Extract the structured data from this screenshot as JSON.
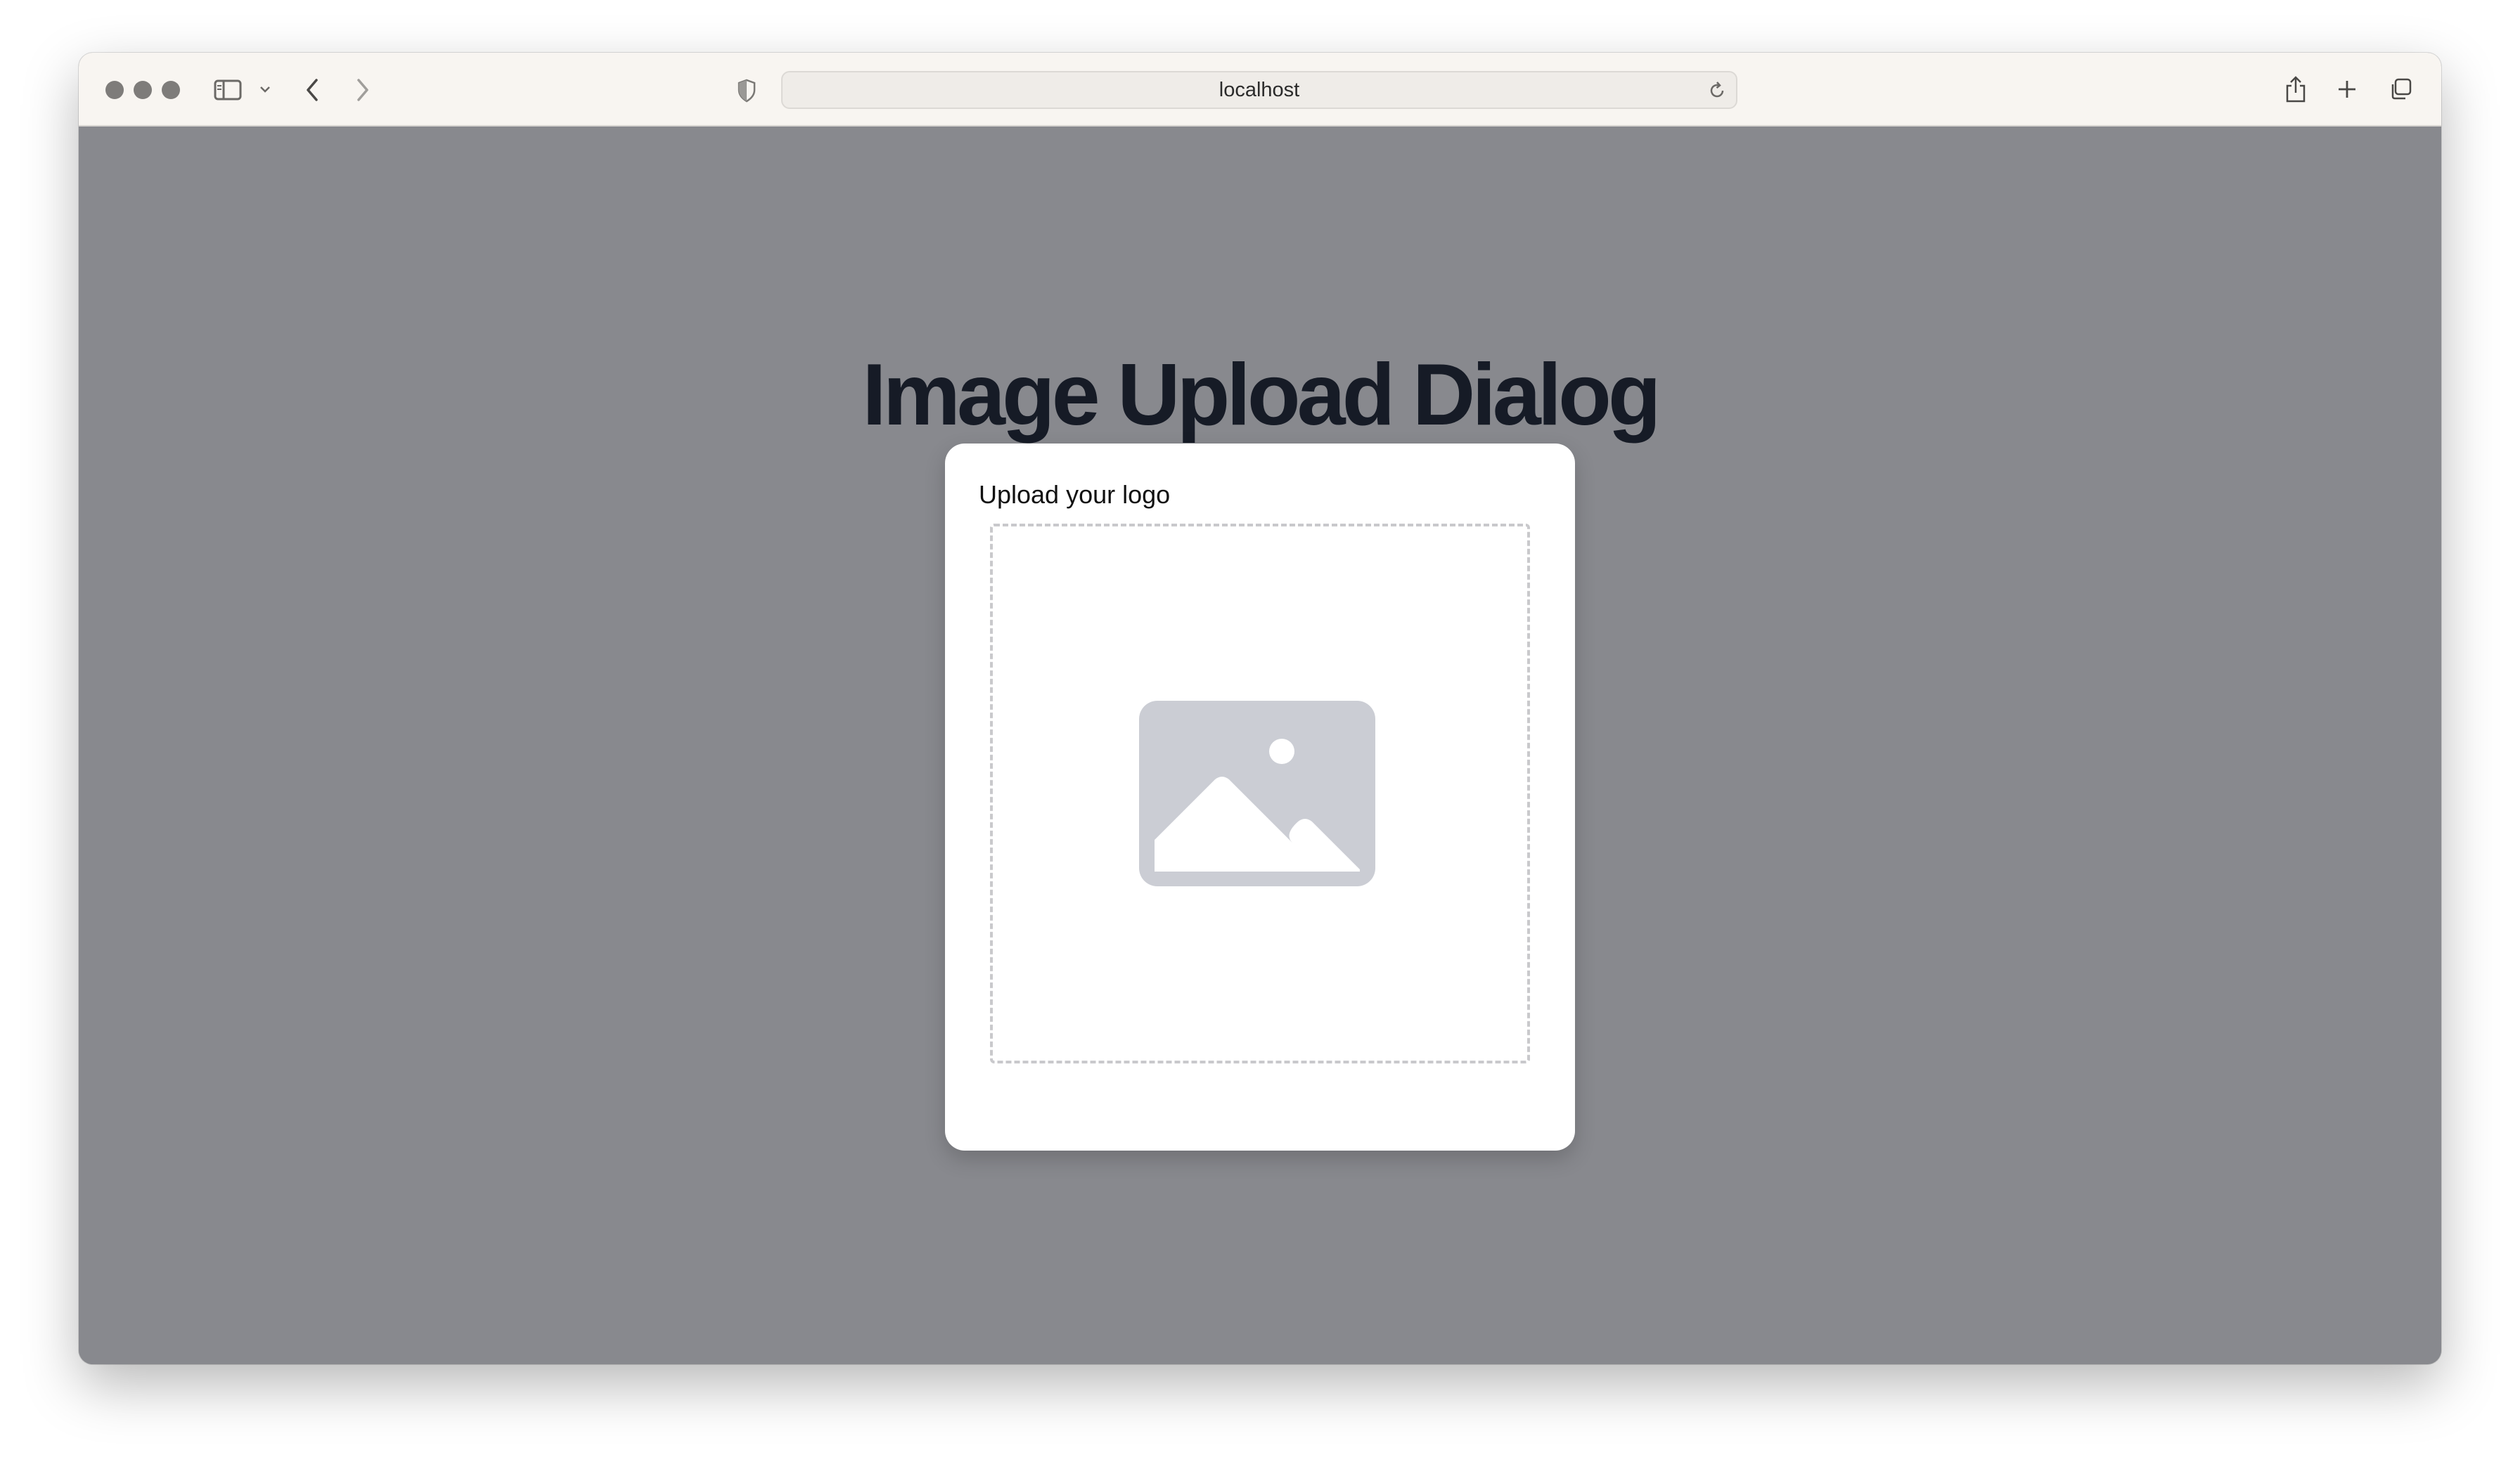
{
  "browser": {
    "url": "localhost",
    "icons": {
      "sidebar": "sidebar-icon",
      "chevron": "chevron-down-icon",
      "back": "back-arrow-icon",
      "forward": "forward-arrow-icon",
      "privacy": "shield-icon",
      "reload": "reload-icon",
      "share": "share-icon",
      "new_tab": "plus-icon",
      "tabs": "tab-overview-icon"
    }
  },
  "page": {
    "heading": "Image Upload Dialog",
    "background_color": "#88898e"
  },
  "dialog": {
    "title": "Upload your logo",
    "dropzone_icon": "image-placeholder-icon",
    "icon_color": "#cbcdd4"
  }
}
